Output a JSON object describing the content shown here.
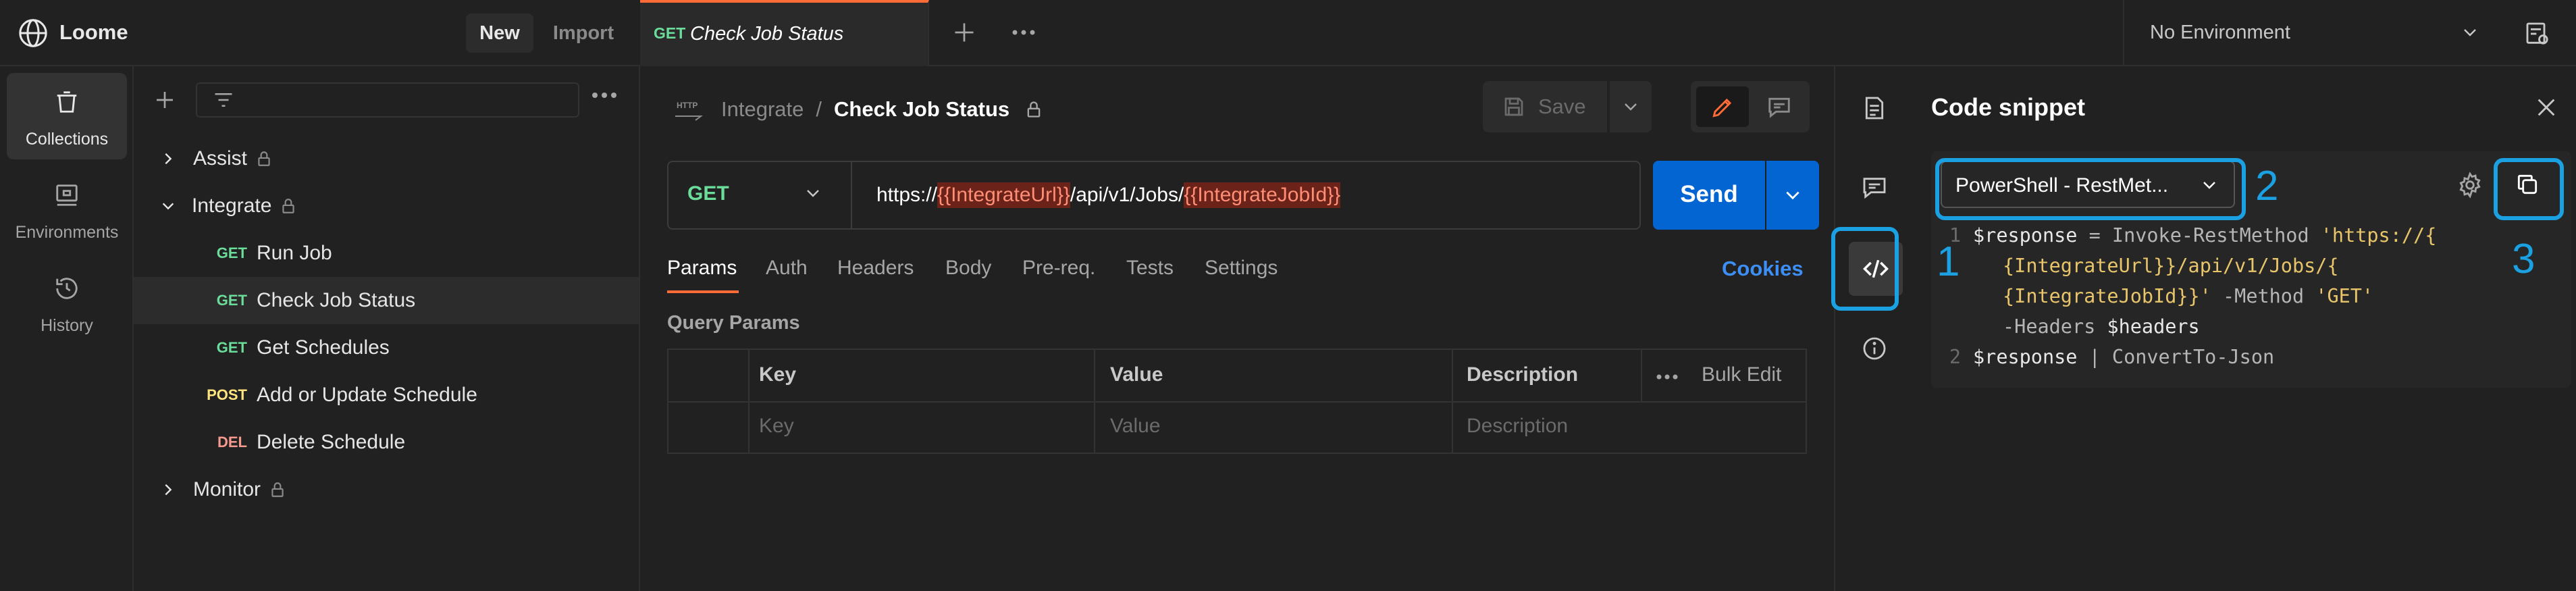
{
  "workspace": {
    "name": "Loome",
    "new_label": "New",
    "import_label": "Import"
  },
  "rail": {
    "items": [
      {
        "label": "Collections",
        "icon": "trash-bin-icon"
      },
      {
        "label": "Environments",
        "icon": "environment-icon"
      },
      {
        "label": "History",
        "icon": "history-icon"
      }
    ]
  },
  "tree": {
    "items": [
      {
        "label": "Assist",
        "type": "folder",
        "expanded": false
      },
      {
        "label": "Integrate",
        "type": "folder",
        "expanded": true
      },
      {
        "method": "GET",
        "label": "Run Job"
      },
      {
        "method": "GET",
        "label": "Check Job Status"
      },
      {
        "method": "GET",
        "label": "Get Schedules"
      },
      {
        "method": "POST",
        "label": "Add or Update Schedule"
      },
      {
        "method": "DEL",
        "label": "Delete Schedule"
      },
      {
        "label": "Monitor",
        "type": "folder",
        "expanded": false
      }
    ]
  },
  "tabs": {
    "active": {
      "method": "GET",
      "title": "Check Job Status"
    },
    "environment": "No Environment"
  },
  "request": {
    "breadcrumb_parent": "Integrate",
    "breadcrumb_sep": "/",
    "title": "Check Job Status",
    "save_label": "Save",
    "method": "GET",
    "url": {
      "prefix": "https://",
      "var1": "{{IntegrateUrl}}",
      "middle": "/api/v1/Jobs/",
      "var2": "{{IntegrateJobId}}"
    },
    "send_label": "Send",
    "subtabs": [
      "Params",
      "Auth",
      "Headers",
      "Body",
      "Pre-req.",
      "Tests",
      "Settings"
    ],
    "cookies_label": "Cookies",
    "query_params_label": "Query Params",
    "table": {
      "headers": {
        "key": "Key",
        "value": "Value",
        "description": "Description",
        "bulk_edit": "Bulk Edit"
      },
      "placeholders": {
        "key": "Key",
        "value": "Value",
        "description": "Description"
      }
    }
  },
  "snippet": {
    "title": "Code snippet",
    "language": "PowerShell - RestMet...",
    "lines": [
      {
        "n": "1",
        "segments": [
          {
            "t": "$response",
            "c": "var"
          },
          {
            "t": " = Invoke-RestMethod ",
            "c": "plain"
          },
          {
            "t": "'https://{",
            "c": "str"
          }
        ]
      },
      {
        "n": "",
        "segments": [
          {
            "t": "{IntegrateUrl}}/api/v1/Jobs/{",
            "c": "str"
          }
        ]
      },
      {
        "n": "",
        "segments": [
          {
            "t": "{IntegrateJobId}}'",
            "c": "str"
          },
          {
            "t": " -Method ",
            "c": "plain"
          },
          {
            "t": "'GET'",
            "c": "str"
          }
        ]
      },
      {
        "n": "",
        "segments": [
          {
            "t": "-Headers ",
            "c": "plain"
          },
          {
            "t": "$headers",
            "c": "var"
          }
        ]
      },
      {
        "n": "2",
        "segments": [
          {
            "t": "$response",
            "c": "var"
          },
          {
            "t": " | ConvertTo-Json",
            "c": "plain"
          }
        ]
      }
    ]
  },
  "annotations": [
    "1",
    "2",
    "3"
  ],
  "colors": {
    "accent_orange": "#ff6c37",
    "send_blue": "#0265d2",
    "annotation_blue": "#1ba1e2",
    "method_get": "#6bdd9a",
    "method_post": "#ffe47e",
    "method_del": "#f79a8e",
    "var_highlight_bg": "#6b2319",
    "var_highlight_fg": "#ff8e76"
  }
}
